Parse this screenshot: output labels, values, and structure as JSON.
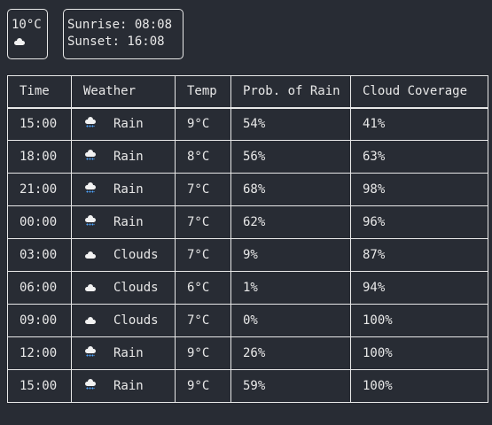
{
  "current": {
    "temperature": "10°C",
    "icon": "cloud-icon"
  },
  "sun": {
    "sunrise": "Sunrise: 08:08",
    "sunset": "Sunset: 16:08"
  },
  "table": {
    "headers": {
      "time": "Time",
      "weather": "Weather",
      "temp": "Temp",
      "rain": "Prob. of Rain",
      "cloud": "Cloud Coverage"
    },
    "rows": [
      {
        "time": "15:00",
        "icon": "rain-cloud-icon",
        "weather": "Rain",
        "temp": "9°C",
        "rain": "54%",
        "cloud": "41%"
      },
      {
        "time": "18:00",
        "icon": "rain-cloud-icon",
        "weather": "Rain",
        "temp": "8°C",
        "rain": "56%",
        "cloud": "63%"
      },
      {
        "time": "21:00",
        "icon": "rain-cloud-icon",
        "weather": "Rain",
        "temp": "7°C",
        "rain": "68%",
        "cloud": "98%"
      },
      {
        "time": "00:00",
        "icon": "rain-cloud-icon",
        "weather": "Rain",
        "temp": "7°C",
        "rain": "62%",
        "cloud": "96%"
      },
      {
        "time": "03:00",
        "icon": "cloud-icon",
        "weather": "Clouds",
        "temp": "7°C",
        "rain": "9%",
        "cloud": "87%"
      },
      {
        "time": "06:00",
        "icon": "cloud-icon",
        "weather": "Clouds",
        "temp": "6°C",
        "rain": "1%",
        "cloud": "94%"
      },
      {
        "time": "09:00",
        "icon": "cloud-icon",
        "weather": "Clouds",
        "temp": "7°C",
        "rain": "0%",
        "cloud": "100%"
      },
      {
        "time": "12:00",
        "icon": "rain-cloud-icon",
        "weather": "Rain",
        "temp": "9°C",
        "rain": "26%",
        "cloud": "100%"
      },
      {
        "time": "15:00",
        "icon": "rain-cloud-icon",
        "weather": "Rain",
        "temp": "9°C",
        "rain": "59%",
        "cloud": "100%"
      }
    ]
  },
  "colors": {
    "background": "#282c34",
    "foreground": "#e8e8e8",
    "rain_drop": "#4ea6ff"
  }
}
